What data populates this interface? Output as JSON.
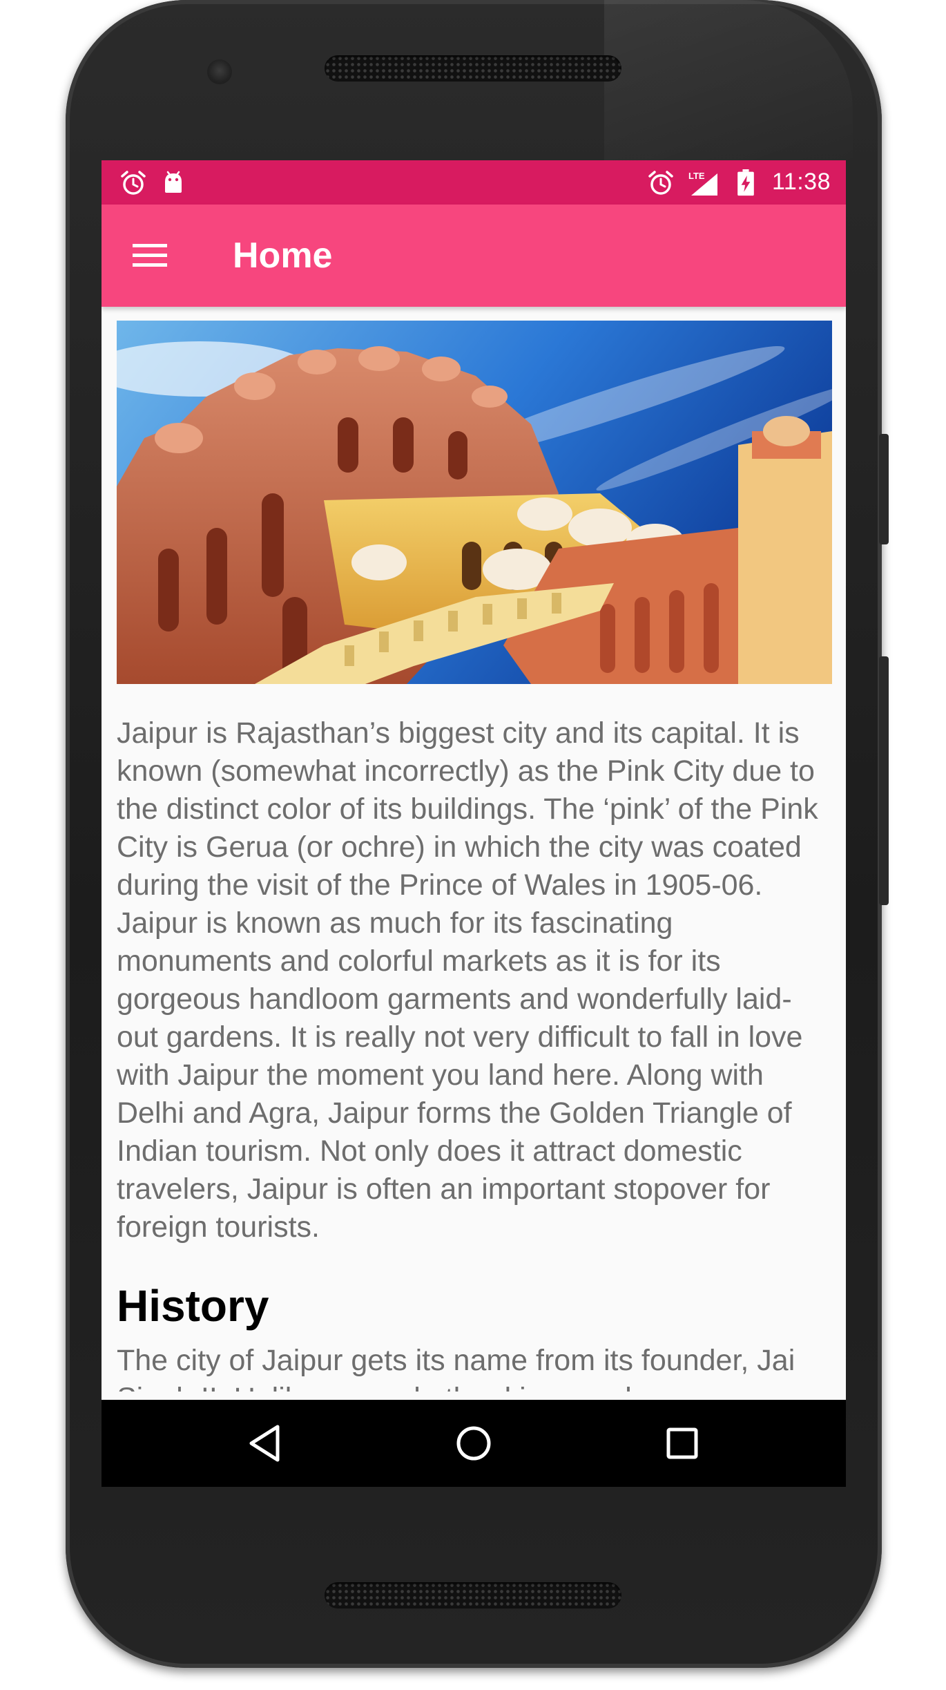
{
  "status_bar": {
    "time": "11:38",
    "network_label": "LTE",
    "left_icons": [
      "alarm-icon",
      "android-debug-icon"
    ],
    "right_icons": [
      "alarm-icon",
      "signal-icon",
      "battery-charging-icon"
    ]
  },
  "app_bar": {
    "title": "Home",
    "menu_icon": "hamburger-menu-icon",
    "color": "#f7467e",
    "status_color": "#d81b60"
  },
  "hero_image": {
    "subject": "Hawa Mahal, Jaipur"
  },
  "intro_text": "Jaipur is Rajasthan’s biggest city and its capital. It is known (somewhat incorrectly) as the Pink City due to the distinct color of its buildings. The ‘pink’ of the Pink City is Gerua (or ochre) in which the city was coated during the visit of the Prince of Wales in 1905-06. Jaipur is known as much for its fascinating monuments and colorful markets as it is for its gorgeous handloom garments and wonderfully laid-out gardens. It is really not very difficult to fall in love with Jaipur the moment you land here. Along with Delhi and Agra, Jaipur forms the Golden Triangle of Indian tourism. Not only does it attract domestic travelers, Jaipur is often an important stopover for foreign tourists.",
  "history": {
    "heading": "History",
    "text": "The city of Jaipur gets its name from its founder, Jai Singh II. Unlike several other kings and"
  },
  "nav_bar": {
    "buttons": [
      "back-icon",
      "home-icon",
      "recents-icon"
    ]
  }
}
